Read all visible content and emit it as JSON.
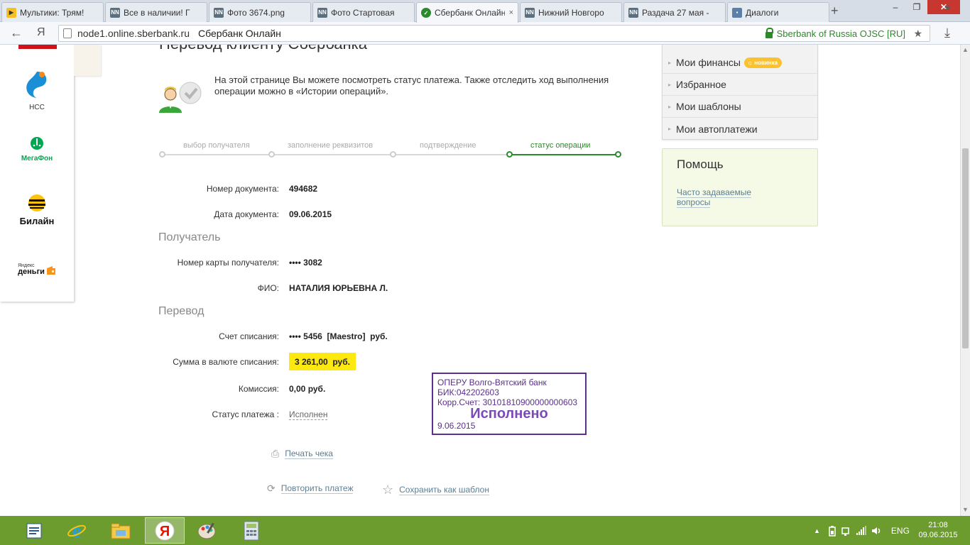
{
  "browser": {
    "tabs": [
      {
        "label": "Мультики: Трям!",
        "icon": "play-icon",
        "color": "#f6c022"
      },
      {
        "label": "Все в наличии! Г",
        "icon": "nn-icon",
        "color": "#5b6f7f"
      },
      {
        "label": "Фото 3674.png",
        "icon": "nn-icon",
        "color": "#5b6f7f"
      },
      {
        "label": "Фото Стартовая",
        "icon": "nn-icon",
        "color": "#5b6f7f"
      },
      {
        "label": "Сбербанк Онлайн",
        "icon": "sberbank-icon",
        "color": "#2c8a2c"
      },
      {
        "label": "Нижний Новгоро",
        "icon": "nn-icon",
        "color": "#5b6f7f"
      },
      {
        "label": "Раздача 27 мая -",
        "icon": "nn-icon",
        "color": "#5b6f7f"
      },
      {
        "label": "Диалоги",
        "icon": "chat-icon",
        "color": "#5b7fa6"
      }
    ],
    "favicon_text": "NN",
    "tab_close_glyph": "×",
    "new_tab_glyph": "+",
    "url": "node1.online.sberbank.ru",
    "page_title": "Сбербанк Онлайн",
    "security_label": "Sberbank of Russia OJSC [RU]",
    "back_glyph": "←",
    "yandex_glyph": "Я",
    "star_glyph": "★",
    "menu_glyph": "≡",
    "download_glyph": "⤓",
    "win_min": "–",
    "win_max": "❐",
    "win_close": "✕"
  },
  "providers": [
    {
      "name": "НСС",
      "icon": "nss-logo-icon"
    },
    {
      "name": "МегаФон",
      "icon": "megafon-logo-icon"
    },
    {
      "name": "Билайн",
      "icon": "beeline-logo-icon"
    },
    {
      "name": "деньги",
      "icon": "yandex-money-logo-icon",
      "prefix": "Яндекс"
    }
  ],
  "page": {
    "title": "Перевод клиенту Сбербанка",
    "intro": "На этой странице Вы можете посмотреть статус платежа. Также отследить ход выполнения операции можно в «Истории операций».",
    "steps": [
      {
        "label": "выбор получателя",
        "active": false
      },
      {
        "label": "заполнение реквизитов",
        "active": false
      },
      {
        "label": "подтверждение",
        "active": false
      },
      {
        "label": "статус операции",
        "active": true
      }
    ],
    "doc_number_label": "Номер документа:",
    "doc_number": "494682",
    "doc_date_label": "Дата документа:",
    "doc_date": "09.06.2015",
    "recipient_section": "Получатель",
    "card_label": "Номер карты получателя:",
    "card_value": "•••• 3082",
    "fio_label": "ФИО:",
    "fio_value": "НАТАЛИЯ ЮРЬЕВНА Л.",
    "transfer_section": "Перевод",
    "account_label": "Счет списания:",
    "account_value": "•••• 5456  [Maestro]  руб.",
    "amount_label": "Сумма в валюте списания:",
    "amount_value": "3 261,00  руб.",
    "fee_label": "Комиссия:",
    "fee_value": "0,00 руб.",
    "status_label": "Статус платежа :",
    "status_value": "Исполнен",
    "stamp": {
      "bank": "ОПЕРУ Волго-Вятский банк",
      "bik": "БИК:042202603",
      "corr": "Корр.Счет: 30101810900000000603",
      "status": "Исполнено",
      "date": "9.06.2015"
    },
    "print_label": "Печать чека",
    "repeat_label": "Повторить платеж",
    "save_template_label": "Сохранить как шаблон",
    "print_glyph": "⎙",
    "repeat_glyph": "⟳",
    "save_glyph": "☆"
  },
  "sidebar": {
    "menu": [
      {
        "label": "Мои финансы",
        "badge": "новинка"
      },
      {
        "label": "Избранное"
      },
      {
        "label": "Мои шаблоны"
      },
      {
        "label": "Мои автоплатежи"
      }
    ],
    "bullet_glyph": "▸",
    "badge_glyph": "☼",
    "help_title": "Помощь",
    "help_link": "Часто задаваемые вопросы"
  },
  "taskbar": {
    "apps": [
      {
        "icon": "wordpad-icon",
        "active": false
      },
      {
        "icon": "internet-explorer-icon",
        "active": false
      },
      {
        "icon": "file-explorer-icon",
        "active": false
      },
      {
        "icon": "yandex-browser-icon",
        "active": true
      },
      {
        "icon": "paint-icon",
        "active": false
      },
      {
        "icon": "calculator-icon",
        "active": false
      }
    ],
    "tray_up": "▲",
    "language": "ENG",
    "time": "21:08",
    "date": "09.06.2015"
  },
  "colors": {
    "sber_green": "#2c8a2c",
    "highlight_yellow": "#fde910",
    "stamp_purple": "#5b2f8c",
    "taskbar_green": "#6d9c2e",
    "badge_orange": "#fcc22e"
  }
}
